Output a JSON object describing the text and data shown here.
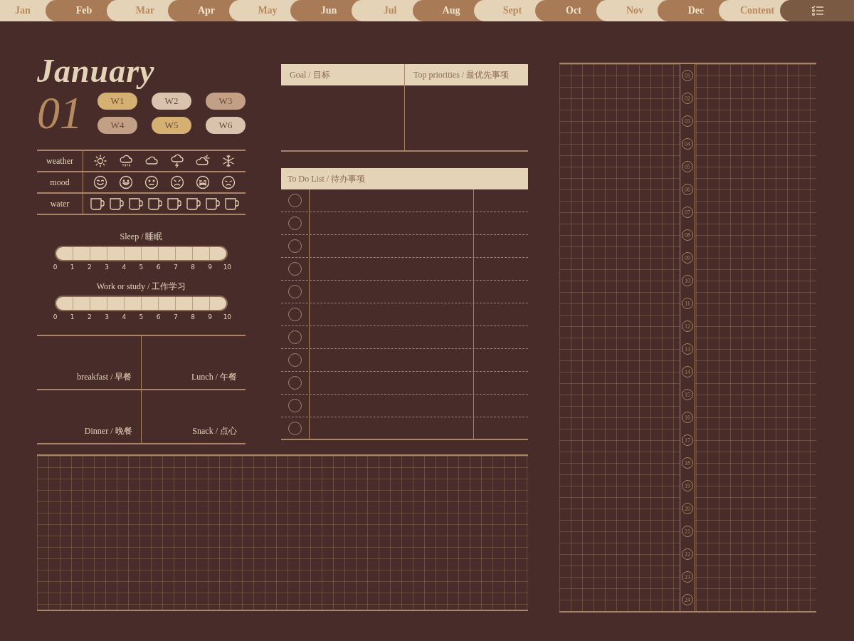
{
  "tabs": [
    {
      "label": "Jan"
    },
    {
      "label": "Feb"
    },
    {
      "label": "Mar"
    },
    {
      "label": "Apr"
    },
    {
      "label": "May"
    },
    {
      "label": "Jun"
    },
    {
      "label": "Jul"
    },
    {
      "label": "Aug"
    },
    {
      "label": "Sept"
    },
    {
      "label": "Oct"
    },
    {
      "label": "Nov"
    },
    {
      "label": "Dec"
    },
    {
      "label": "Content"
    }
  ],
  "month": {
    "title": "January",
    "number": "01"
  },
  "weeks": [
    {
      "label": "W1",
      "color": "#d4b072"
    },
    {
      "label": "W2",
      "color": "#d9c3ae"
    },
    {
      "label": "W3",
      "color": "#c39f86"
    },
    {
      "label": "W4",
      "color": "#c39f86"
    },
    {
      "label": "W5",
      "color": "#d4b072"
    },
    {
      "label": "W6",
      "color": "#d9c3ae"
    }
  ],
  "trackers": [
    {
      "label": "weather",
      "kind": "weather"
    },
    {
      "label": "mood",
      "kind": "mood"
    },
    {
      "label": "water",
      "kind": "water"
    }
  ],
  "scales": [
    {
      "title": "Sleep / 睡眠",
      "ticks": [
        "0",
        "1",
        "2",
        "3",
        "4",
        "5",
        "6",
        "7",
        "8",
        "9",
        "10"
      ]
    },
    {
      "title": "Work or study / 工作学习",
      "ticks": [
        "0",
        "1",
        "2",
        "3",
        "4",
        "5",
        "6",
        "7",
        "8",
        "9",
        "10"
      ]
    }
  ],
  "meals": [
    "breakfast / 早餐",
    "Lunch / 午餐",
    "Dinner / 晚餐",
    "Snack / 点心"
  ],
  "goal_headers": [
    "Goal / 目标",
    "Top priorities / 最优先事项"
  ],
  "todo": {
    "title": "To Do List / 待办事项",
    "items": [
      {
        "checked": false
      },
      {
        "checked": false
      },
      {
        "checked": false
      },
      {
        "checked": false
      },
      {
        "checked": false
      },
      {
        "checked": false
      },
      {
        "checked": false
      },
      {
        "checked": false
      },
      {
        "checked": false
      },
      {
        "checked": false
      },
      {
        "checked": false
      }
    ]
  },
  "hours": [
    "01",
    "02",
    "03",
    "04",
    "05",
    "06",
    "07",
    "08",
    "09",
    "10",
    "11",
    "12",
    "13",
    "14",
    "15",
    "16",
    "17",
    "18",
    "19",
    "20",
    "21",
    "22",
    "23",
    "24"
  ]
}
